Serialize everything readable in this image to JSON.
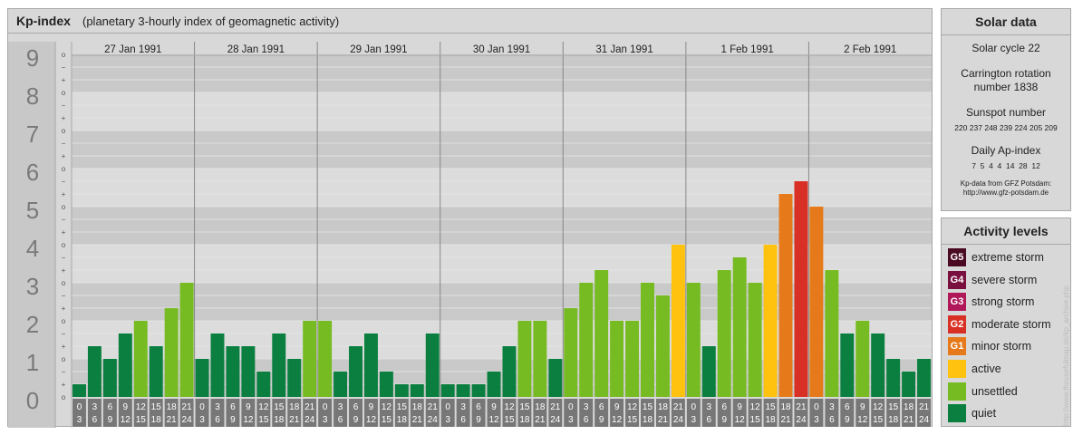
{
  "title": "Kp-index",
  "subtitle": "(planetary 3-hourly index of geomagnetic activity)",
  "chart_data": {
    "type": "bar",
    "title": "Kp-index",
    "ylim": [
      0,
      9
    ],
    "y_major_ticks": [
      "0",
      "1",
      "2",
      "3",
      "4",
      "5",
      "6",
      "7",
      "8",
      "9"
    ],
    "y_minor_labels": [
      "o",
      "+",
      "−",
      "o",
      "+",
      "−",
      "o",
      "+",
      "−",
      "o",
      "+",
      "−",
      "o",
      "+",
      "−",
      "o",
      "+",
      "−",
      "o",
      "+",
      "−",
      "o",
      "+",
      "−",
      "o",
      "+",
      "−",
      "o"
    ],
    "days": [
      "27 Jan 1991",
      "28 Jan 1991",
      "29 Jan 1991",
      "30 Jan 1991",
      "31 Jan 1991",
      "1 Feb 1991",
      "2 Feb 1991"
    ],
    "interval_labels": [
      [
        "0",
        "3"
      ],
      [
        "3",
        "6"
      ],
      [
        "6",
        "9"
      ],
      [
        "9",
        "12"
      ],
      [
        "12",
        "15"
      ],
      [
        "15",
        "18"
      ],
      [
        "18",
        "21"
      ],
      [
        "21",
        "24"
      ]
    ],
    "series": [
      {
        "day": "27 Jan 1991",
        "values": [
          0.333,
          1.333,
          1.0,
          1.667,
          2.0,
          1.333,
          2.333,
          3.0
        ]
      },
      {
        "day": "28 Jan 1991",
        "values": [
          1.0,
          1.667,
          1.333,
          1.333,
          0.667,
          1.667,
          1.0,
          2.0
        ]
      },
      {
        "day": "29 Jan 1991",
        "values": [
          2.0,
          0.667,
          1.333,
          1.667,
          0.667,
          0.333,
          0.333,
          1.667
        ]
      },
      {
        "day": "30 Jan 1991",
        "values": [
          0.333,
          0.333,
          0.333,
          0.667,
          1.333,
          2.0,
          2.0,
          1.0
        ]
      },
      {
        "day": "31 Jan 1991",
        "values": [
          2.333,
          3.0,
          3.333,
          2.0,
          2.0,
          3.0,
          2.667,
          4.0
        ]
      },
      {
        "day": "1 Feb 1991",
        "values": [
          3.0,
          1.333,
          3.333,
          3.667,
          3.0,
          4.0,
          5.333,
          5.667
        ]
      },
      {
        "day": "2 Feb 1991",
        "values": [
          5.0,
          3.333,
          1.667,
          2.0,
          1.667,
          1.0,
          0.667,
          1.0
        ]
      }
    ],
    "color_levels": [
      {
        "min": 0,
        "max": 2.0,
        "color": "#0a7f3f"
      },
      {
        "min": 2.0,
        "max": 4.0,
        "color": "#77bb22"
      },
      {
        "min": 4.0,
        "max": 5.0,
        "color": "#ffc20e"
      },
      {
        "min": 5.0,
        "max": 5.5,
        "color": "#e67a1a"
      },
      {
        "min": 5.5,
        "max": 6.5,
        "color": "#d93025"
      }
    ],
    "colors": {
      "quiet": "#0a7f3f",
      "unsettled": "#77bb22",
      "active": "#ffc20e",
      "minor": "#e67a1a",
      "moderate": "#d93025"
    }
  },
  "solar": {
    "heading": "Solar data",
    "cycle": "Solar cycle 22",
    "carrington_line1": "Carrington rotation",
    "carrington_line2": "number 1838",
    "sunspot_heading": "Sunspot number",
    "sunspot_values": "220 237 248 239 224 205 209",
    "ap_heading": "Daily Ap-index",
    "ap_values": "7  5  4  4  14  28  12",
    "source_line1": "Kp-data from GFZ Potsdam:",
    "source_line2": "http://www.gfz-potsdam.de"
  },
  "activity": {
    "heading": "Activity levels",
    "levels": [
      {
        "badge": "G5",
        "label": "extreme storm",
        "color": "#4a0a22"
      },
      {
        "badge": "G4",
        "label": "severe storm",
        "color": "#7a1040"
      },
      {
        "badge": "G3",
        "label": "strong storm",
        "color": "#b0185a"
      },
      {
        "badge": "G2",
        "label": "moderate storm",
        "color": "#d93025"
      },
      {
        "badge": "G1",
        "label": "minor storm",
        "color": "#e67a1a"
      },
      {
        "badge": "",
        "label": "active",
        "color": "#ffc20e"
      },
      {
        "badge": "",
        "label": "unsettled",
        "color": "#77bb22"
      },
      {
        "badge": "",
        "label": "quiet",
        "color": "#0a7f3f"
      }
    ]
  },
  "watermark": "http://www.theusefulmap.de/kp_archive.php"
}
